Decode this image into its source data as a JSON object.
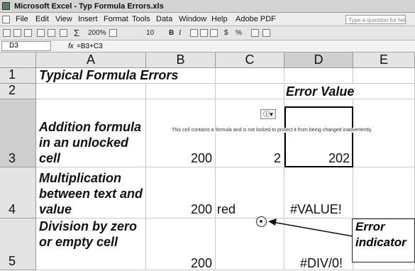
{
  "window": {
    "title": "Microsoft Excel - Typ Formula Errors.xls"
  },
  "menu": [
    "File",
    "Edit",
    "View",
    "Insert",
    "Format",
    "Tools",
    "Data",
    "Window",
    "Help",
    "Adobe PDF"
  ],
  "help_placeholder": "Type a question for help",
  "toolbar": {
    "zoom": "200%",
    "font_size": "10",
    "bold": "B",
    "italic": "I",
    "currency": "$",
    "percent": "%"
  },
  "formula_bar": {
    "name_box": "D3",
    "fx": "fx",
    "formula": "=B3+C3"
  },
  "columns": [
    "A",
    "B",
    "C",
    "D",
    "E"
  ],
  "rows": [
    "1",
    "2",
    "3",
    "4",
    "5"
  ],
  "cells": {
    "a1": "Typical Formula Errors",
    "d2": "Error Value",
    "a3": "Addition formula in an unlocked cell",
    "b3": "200",
    "c3": "2",
    "d3": "202",
    "a4": "Multiplication between text and value",
    "b4": "200",
    "c4": "red",
    "d4": "#VALUE!",
    "a5": "Division by zero or empty cell",
    "b5": "200",
    "d5": "#DIV/0!"
  },
  "tooltip": "This cell contains a formula and is not locked to protect it from being changed inadvertently.",
  "callout": "Error indicator"
}
